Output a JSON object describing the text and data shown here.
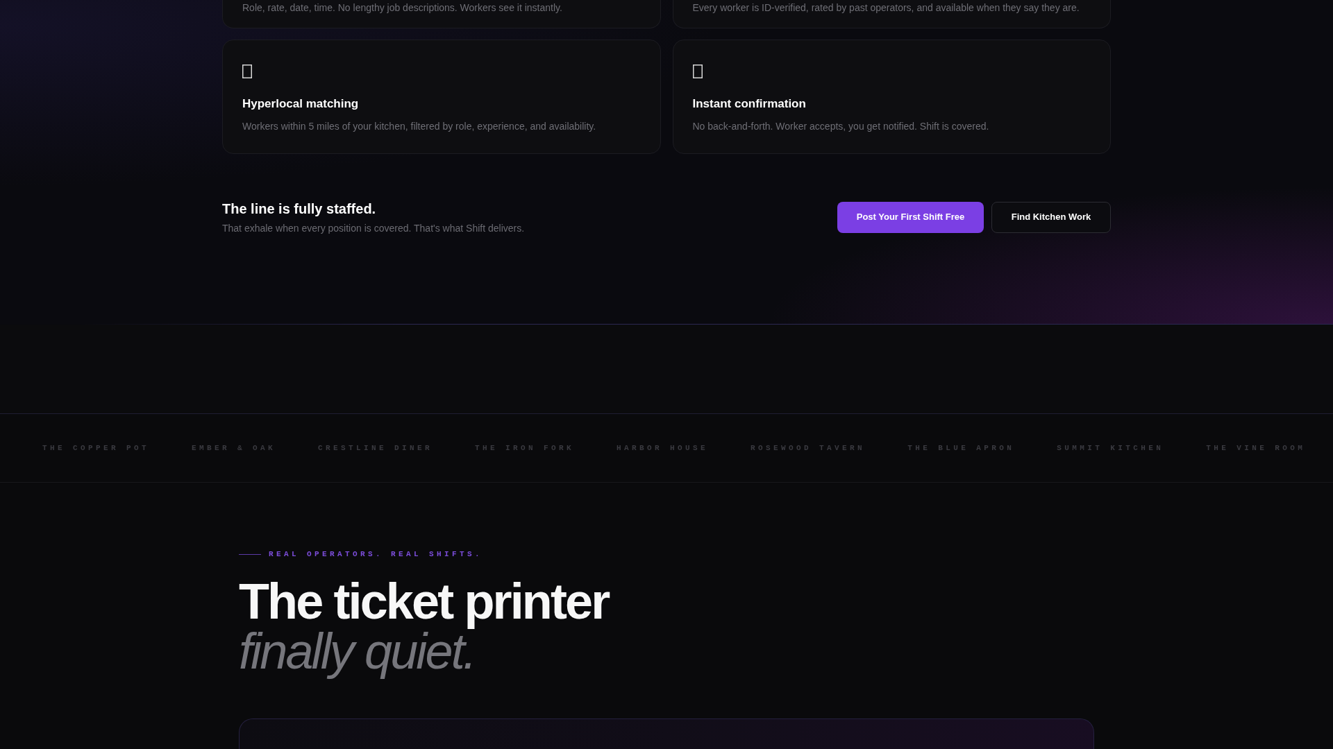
{
  "features": [
    {
      "description": "Role, rate, date, time. No lengthy job descriptions. Workers see it instantly."
    },
    {
      "description": "Every worker is ID-verified, rated by past operators, and available when they say they are."
    },
    {
      "title": "Hyperlocal matching",
      "description": "Workers within 5 miles of your kitchen, filtered by role, experience, and availability."
    },
    {
      "title": "Instant confirmation",
      "description": "No back-and-forth. Worker accepts, you get notified. Shift is covered."
    }
  ],
  "cta": {
    "title": "The line is fully staffed.",
    "subtitle": "That exhale when every position is covered. That's what Shift delivers.",
    "buttons": [
      {
        "label": "Post Your First Shift Free",
        "kind": "primary"
      },
      {
        "label": "Find Kitchen Work",
        "kind": "secondary"
      }
    ]
  },
  "logos": [
    "THE COPPER POT",
    "EMBER & OAK",
    "CRESTLINE DINER",
    "THE IRON FORK",
    "HARBOR HOUSE",
    "ROSEWOOD TAVERN",
    "THE BLUE APRON",
    "SUMMIT KITCHEN",
    "THE VINE ROOM"
  ],
  "testimonials": {
    "eyebrow": "REAL OPERATORS. REAL SHIFTS.",
    "heading": "The ticket printer",
    "heading_emphasis": "finally quiet."
  }
}
